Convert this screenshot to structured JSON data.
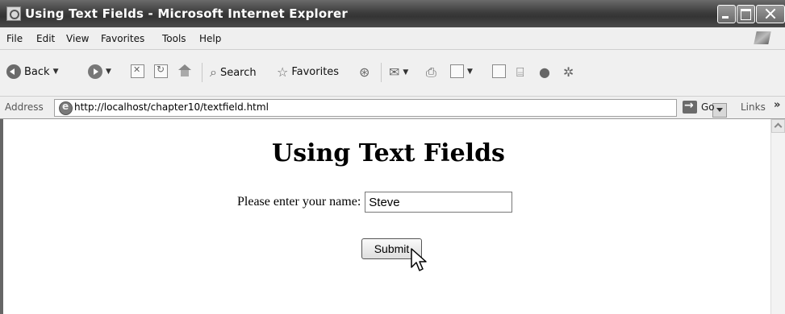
{
  "window": {
    "title": "Using Text Fields - Microsoft Internet Explorer"
  },
  "menu": {
    "items": [
      "File",
      "Edit",
      "View",
      "Favorites",
      "Tools",
      "Help"
    ]
  },
  "toolbar": {
    "back_label": "Back",
    "search_label": "Search",
    "favorites_label": "Favorites"
  },
  "addressbar": {
    "label": "Address",
    "url": "http://localhost/chapter10/textfield.html",
    "go_label": "Go",
    "links_label": "Links",
    "links_chevron": "»"
  },
  "page": {
    "heading": "Using Text Fields",
    "name_label": "Please enter your name:",
    "name_value": "Steve",
    "submit_label": "Submit"
  }
}
